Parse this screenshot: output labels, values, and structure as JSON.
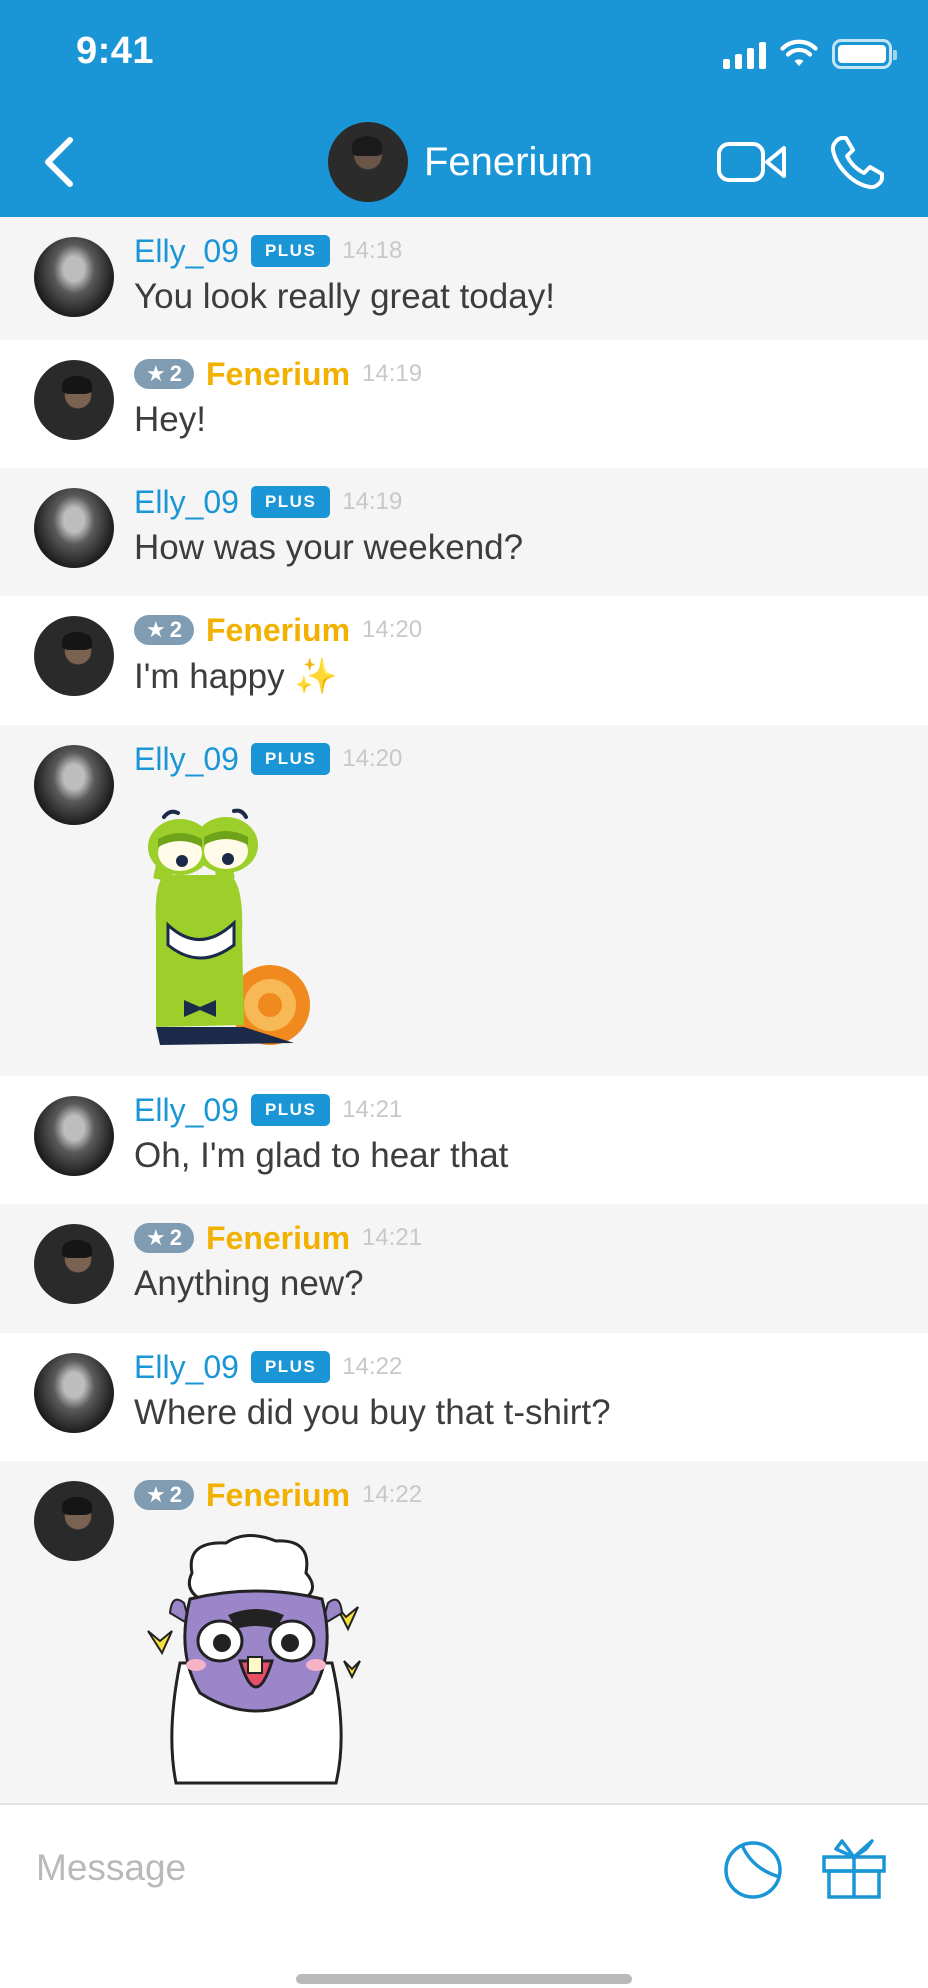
{
  "status_bar": {
    "time": "9:41"
  },
  "header": {
    "back_icon": "chevron-left-icon",
    "title": "Fenerium",
    "video_icon": "video-camera-icon",
    "call_icon": "phone-icon"
  },
  "colors": {
    "accent": "#1a95d6",
    "gold": "#f2b100",
    "level_badge": "#7f9cb2",
    "alt_row": "#f5f5f5"
  },
  "messages": [
    {
      "user": "Elly_09",
      "badge": "PLUS",
      "time": "14:18",
      "text": "You look really great today!"
    },
    {
      "user": "Fenerium",
      "level": "2",
      "time": "14:19",
      "text": "Hey!"
    },
    {
      "user": "Elly_09",
      "badge": "PLUS",
      "time": "14:19",
      "text": "How was your weekend?"
    },
    {
      "user": "Fenerium",
      "level": "2",
      "time": "14:20",
      "text": "I'm happy",
      "emoji": "✨"
    },
    {
      "user": "Elly_09",
      "badge": "PLUS",
      "time": "14:20",
      "sticker": "snail-sticker"
    },
    {
      "user": "Elly_09",
      "badge": "PLUS",
      "time": "14:21",
      "text": "Oh, I'm glad to hear that"
    },
    {
      "user": "Fenerium",
      "level": "2",
      "time": "14:21",
      "text": "Anything new?"
    },
    {
      "user": "Elly_09",
      "badge": "PLUS",
      "time": "14:22",
      "text": "Where did you buy that t-shirt?"
    },
    {
      "user": "Fenerium",
      "level": "2",
      "time": "14:22",
      "sticker": "llama-sticker"
    }
  ],
  "composer": {
    "placeholder": "Message",
    "sticker_icon": "sticker-icon",
    "gift_icon": "gift-icon"
  }
}
